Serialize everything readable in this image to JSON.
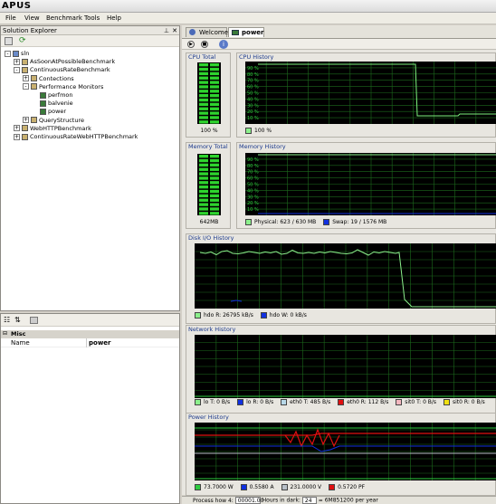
{
  "app": {
    "title": "APUS"
  },
  "menu": [
    "File",
    "View",
    "Benchmark",
    "Tools",
    "Help"
  ],
  "solution_explorer": {
    "title": "Solution Explorer",
    "tree": [
      {
        "label": "sln",
        "indent": 0,
        "expander": "-"
      },
      {
        "label": "AsSoonAtPossibleBenchmark",
        "indent": 1,
        "expander": "+"
      },
      {
        "label": "ContinuousRateBenchmark",
        "indent": 1,
        "expander": "-"
      },
      {
        "label": "Contections",
        "indent": 2,
        "expander": "+"
      },
      {
        "label": "Performance Monitors",
        "indent": 2,
        "expander": "-"
      },
      {
        "label": "perfmon",
        "indent": 3,
        "expander": ""
      },
      {
        "label": "balvenie",
        "indent": 3,
        "expander": ""
      },
      {
        "label": "power",
        "indent": 3,
        "expander": ""
      },
      {
        "label": "QueryStructure",
        "indent": 2,
        "expander": "+"
      },
      {
        "label": "WebHTTPBenchmark",
        "indent": 1,
        "expander": "+"
      },
      {
        "label": "ContinuousRateWebHTTPBenchmark",
        "indent": 1,
        "expander": "+"
      }
    ]
  },
  "properties": {
    "category": "Misc",
    "rows": [
      {
        "name": "Name",
        "value": "power"
      }
    ]
  },
  "tabs": [
    {
      "label": "Welcome",
      "active": false
    },
    {
      "label": "power",
      "active": true
    }
  ],
  "panels": {
    "cpu_total": {
      "title": "CPU Total",
      "value": "100 %",
      "fill": 1.0
    },
    "cpu_history": {
      "title": "CPU History",
      "legend": [
        "100 %"
      ],
      "ticks": [
        "90 %",
        "80 %",
        "70 %",
        "60 %",
        "50 %",
        "40 %",
        "30 %",
        "20 %",
        "10 %"
      ]
    },
    "mem_total": {
      "title": "Memory Total",
      "value": "642MB",
      "fill": 0.98
    },
    "mem_history": {
      "title": "Memory History",
      "legend": [
        "Physical: 623 / 630 MB",
        "Swap: 19 / 1576 MB"
      ],
      "ticks": [
        "90 %",
        "80 %",
        "70 %",
        "60 %",
        "50 %",
        "40 %",
        "30 %",
        "20 %",
        "10 %"
      ]
    },
    "disk_history": {
      "title": "Disk I/O History",
      "legend": [
        "hdo R: 26795 kB/s",
        "hdo W: 0 kB/s"
      ]
    },
    "net_history": {
      "title": "Network History",
      "legend": [
        "lo T: 0 B/s",
        "lo R: 0 B/s",
        "eth0 T: 485 B/s",
        "eth0 R: 112 B/s",
        "sit0 T: 0 B/s",
        "sit0 R: 0 B/s"
      ]
    },
    "power_history": {
      "title": "Power History",
      "legend": [
        "73.7000 W",
        "0.5580 A",
        "231.0000 V",
        "0.5720 PF"
      ]
    }
  },
  "colors": {
    "cpu_line": "#7cf07c",
    "physical": "#8cf08c",
    "swap": "#1030e0",
    "disk_read": "#8cf08c",
    "disk_write": "#1030e0",
    "power_w": "#2ecc40",
    "power_a": "#1030e0",
    "power_v": "#b8c0c8",
    "power_pf": "#e01010"
  },
  "status": {
    "label_left": "Process how 4:",
    "input1": "00001.00",
    "label_mid": "Hours in dark:",
    "input2": "24",
    "label_right": "= 6M851200 per year"
  }
}
